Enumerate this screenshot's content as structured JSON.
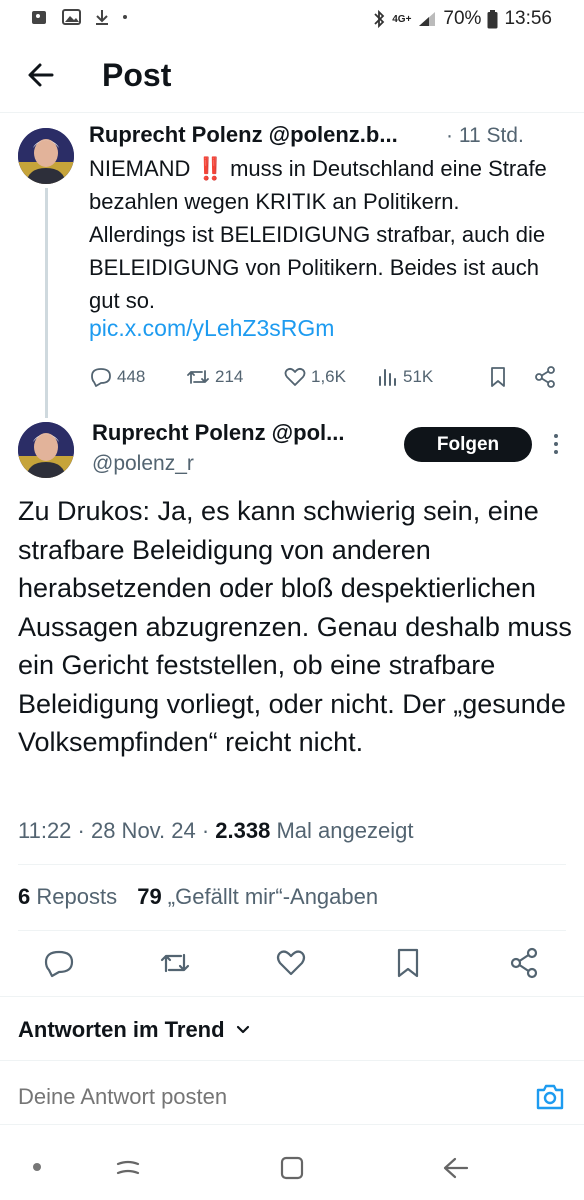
{
  "status_bar": {
    "network": "4G+",
    "battery": "70%",
    "time": "13:56"
  },
  "header": {
    "title": "Post"
  },
  "quoted_tweet": {
    "display": "Ruprecht Polenz @polenz.b...",
    "time": "· 11 Std.",
    "text": "NIEMAND ‼️ muss in Deutschland eine Strafe bezahlen wegen KRITIK an Politikern. Allerdings ist BELEIDIGUNG strafbar, auch die BELEIDIGUNG von Politikern. Beides ist auch gut so.",
    "link": "pic.x.com/yLehZ3sRGm",
    "replies": "448",
    "reposts": "214",
    "likes": "1,6K",
    "views": "51K"
  },
  "main_tweet": {
    "display": "Ruprecht Polenz @pol...",
    "handle": "@polenz_r",
    "follow_label": "Folgen",
    "text": "Zu Drukos: Ja, es kann schwierig sein, eine strafbare Beleidigung von anderen herabsetzenden oder bloß despektierlichen Aussagen abzugrenzen. Genau deshalb muss ein Gericht feststellen, ob eine strafbare Beleidigung vorliegt, oder nicht. Der „gesunde Volksempfinden“ reicht nicht.",
    "time": "11:22 · 28 Nov. 24 · ",
    "views_count": "2.338",
    "views_label": " Mal angezeigt",
    "reposts_count": "6",
    "reposts_label": " Reposts",
    "likes_count": "79",
    "likes_label": " „Gefällt mir“-Angaben"
  },
  "replies_section": {
    "trend_label": "Antworten im Trend",
    "reply_placeholder": "Deine Antwort posten"
  },
  "colors": {
    "accent": "#1d9bf0",
    "text": "#0f1419",
    "secondary": "#536471"
  }
}
